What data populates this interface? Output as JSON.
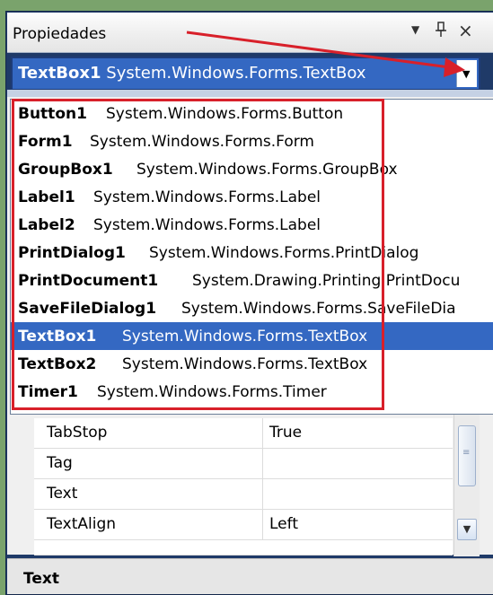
{
  "titlebar": {
    "title": "Propiedades",
    "dropdown_icon": "▼",
    "pin_icon": "pin-icon",
    "close_icon": "×"
  },
  "object_combo": {
    "name": "TextBox1",
    "type": "System.Windows.Forms.TextBox",
    "button": "▼"
  },
  "dropdown": {
    "items": [
      {
        "name": "Button1",
        "type": "System.Windows.Forms.Button",
        "selected": false
      },
      {
        "name": "Form1",
        "type": "System.Windows.Forms.Form",
        "selected": false
      },
      {
        "name": "GroupBox1",
        "type": "System.Windows.Forms.GroupBox",
        "selected": false
      },
      {
        "name": "Label1",
        "type": "System.Windows.Forms.Label",
        "selected": false
      },
      {
        "name": "Label2",
        "type": "System.Windows.Forms.Label",
        "selected": false
      },
      {
        "name": "PrintDialog1",
        "type": "System.Windows.Forms.PrintDialog",
        "selected": false
      },
      {
        "name": "PrintDocument1",
        "type": "System.Drawing.Printing.PrintDocu",
        "selected": false
      },
      {
        "name": "SaveFileDialog1",
        "type": "System.Windows.Forms.SaveFileDia",
        "selected": false
      },
      {
        "name": "TextBox1",
        "type": "System.Windows.Forms.TextBox",
        "selected": true
      },
      {
        "name": "TextBox2",
        "type": "System.Windows.Forms.TextBox",
        "selected": false
      },
      {
        "name": "Timer1",
        "type": "System.Windows.Forms.Timer",
        "selected": false
      }
    ]
  },
  "grid": {
    "rows": [
      {
        "key": "TabStop",
        "value": "True"
      },
      {
        "key": "Tag",
        "value": ""
      },
      {
        "key": "Text",
        "value": ""
      },
      {
        "key": "TextAlign",
        "value": "Left"
      }
    ]
  },
  "description": {
    "title": "Text"
  },
  "colors": {
    "selection": "#3468c2",
    "highlight_box": "#d8202a",
    "background": "#7aa36c"
  }
}
